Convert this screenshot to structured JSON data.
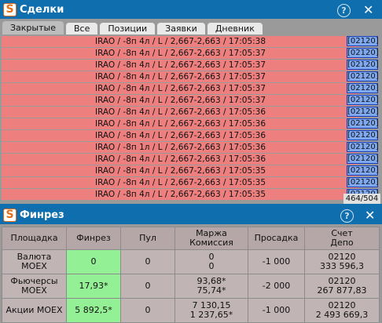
{
  "deals_window": {
    "title": "Сделки",
    "help": "?",
    "close": "✕",
    "tabs": [
      "Закрытые",
      "Все",
      "Позиции",
      "Заявки",
      "Дневник"
    ],
    "active_tab": "Закрытые",
    "rows": [
      {
        "text": "IRAO / -8п 4л / L / 2,667-2,663 / 17:05:38",
        "account": "[02120]"
      },
      {
        "text": "IRAO / -8п 4л / L / 2,667-2,663 / 17:05:37",
        "account": "[02120]"
      },
      {
        "text": "IRAO / -8п 4л / L / 2,667-2,663 / 17:05:37",
        "account": "[02120]"
      },
      {
        "text": "IRAO / -8п 4л / L / 2,667-2,663 / 17:05:37",
        "account": "[02120]"
      },
      {
        "text": "IRAO / -8п 4л / L / 2,667-2,663 / 17:05:37",
        "account": "[02120]"
      },
      {
        "text": "IRAO / -8п 4л / L / 2,667-2,663 / 17:05:37",
        "account": "[02120]"
      },
      {
        "text": "IRAO / -8п 4л / L / 2,667-2,663 / 17:05:36",
        "account": "[02120]"
      },
      {
        "text": "IRAO / -8п 4л / L / 2,667-2,663 / 17:05:36",
        "account": "[02120]"
      },
      {
        "text": "IRAO / -8п 4л / L / 2,667-2,663 / 17:05:36",
        "account": "[02120]"
      },
      {
        "text": "IRAO / -8п 1л / L / 2,667-2,663 / 17:05:36",
        "account": "[02120]"
      },
      {
        "text": "IRAO / -8п 4л / L / 2,667-2,663 / 17:05:36",
        "account": "[02120]"
      },
      {
        "text": "IRAO / -8п 4л / L / 2,667-2,663 / 17:05:35",
        "account": "[02120]"
      },
      {
        "text": "IRAO / -8п 4л / L / 2,667-2,663 / 17:05:35",
        "account": "[02120]"
      },
      {
        "text": "IRAO / -8п 4л / L / 2,667-2,663 / 17:05:35",
        "account": "[02120]"
      }
    ],
    "counter": "464/504"
  },
  "finres_window": {
    "title": "Финрез",
    "help": "?",
    "close": "✕",
    "headers": {
      "venue": "Площадка",
      "finres": "Финрез",
      "pul": "Пул",
      "margin": "Маржа",
      "commission": "Комиссия",
      "drawdown": "Просадка",
      "account": "Счет",
      "depo": "Депо"
    },
    "rows": [
      {
        "venue": [
          "Валюта",
          "MOEX"
        ],
        "finres": "0",
        "pul": "0",
        "margin": [
          "0",
          "0"
        ],
        "drawdown": "-1 000",
        "account": [
          "02120",
          "333 596,3"
        ]
      },
      {
        "venue": [
          "Фьючерсы",
          "MOEX"
        ],
        "finres": "17,93*",
        "pul": "0",
        "margin": [
          "93,68*",
          "75,74*"
        ],
        "drawdown": "-2 000",
        "account": [
          "02120",
          "267 877,83"
        ]
      },
      {
        "venue": [
          "Акции MOEX"
        ],
        "finres": "5 892,5*",
        "pul": "0",
        "margin": [
          "7 130,15",
          "1 237,65*"
        ],
        "drawdown": "-1 000",
        "account": [
          "02120",
          "2 493 669,3"
        ]
      }
    ]
  },
  "colors": {
    "titlebar": "#0f6fae",
    "row_loss": "#ee7f7f",
    "account_badge": "#7ea9f0",
    "finres_positive": "#94f094",
    "logo_accent": "#e0701c"
  }
}
